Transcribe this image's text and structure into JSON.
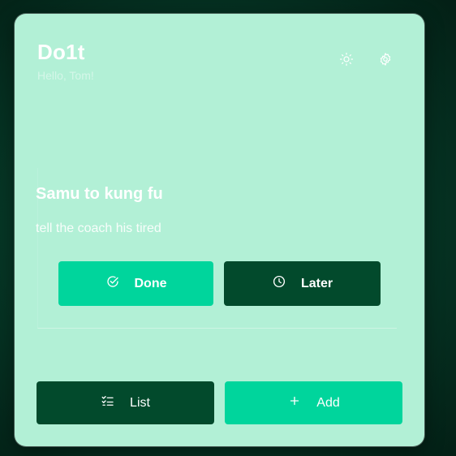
{
  "app": {
    "title": "Do1t",
    "greeting": "Hello, Tom!"
  },
  "header": {
    "theme_icon": "sun-icon",
    "settings_icon": "gear-icon"
  },
  "task": {
    "title": "Samu to kung fu",
    "note": "tell the coach his tired",
    "done_label": "Done",
    "done_icon": "check-circle-icon",
    "later_label": "Later",
    "later_icon": "clock-icon"
  },
  "footer": {
    "list_label": "List",
    "list_icon": "checklist-icon",
    "add_label": "Add",
    "add_icon": "plus-icon"
  },
  "colors": {
    "background": "#063726",
    "card": "#b2f0d6",
    "accent": "#00d59c",
    "dark_button": "#024a2c",
    "text": "#ffffff"
  }
}
